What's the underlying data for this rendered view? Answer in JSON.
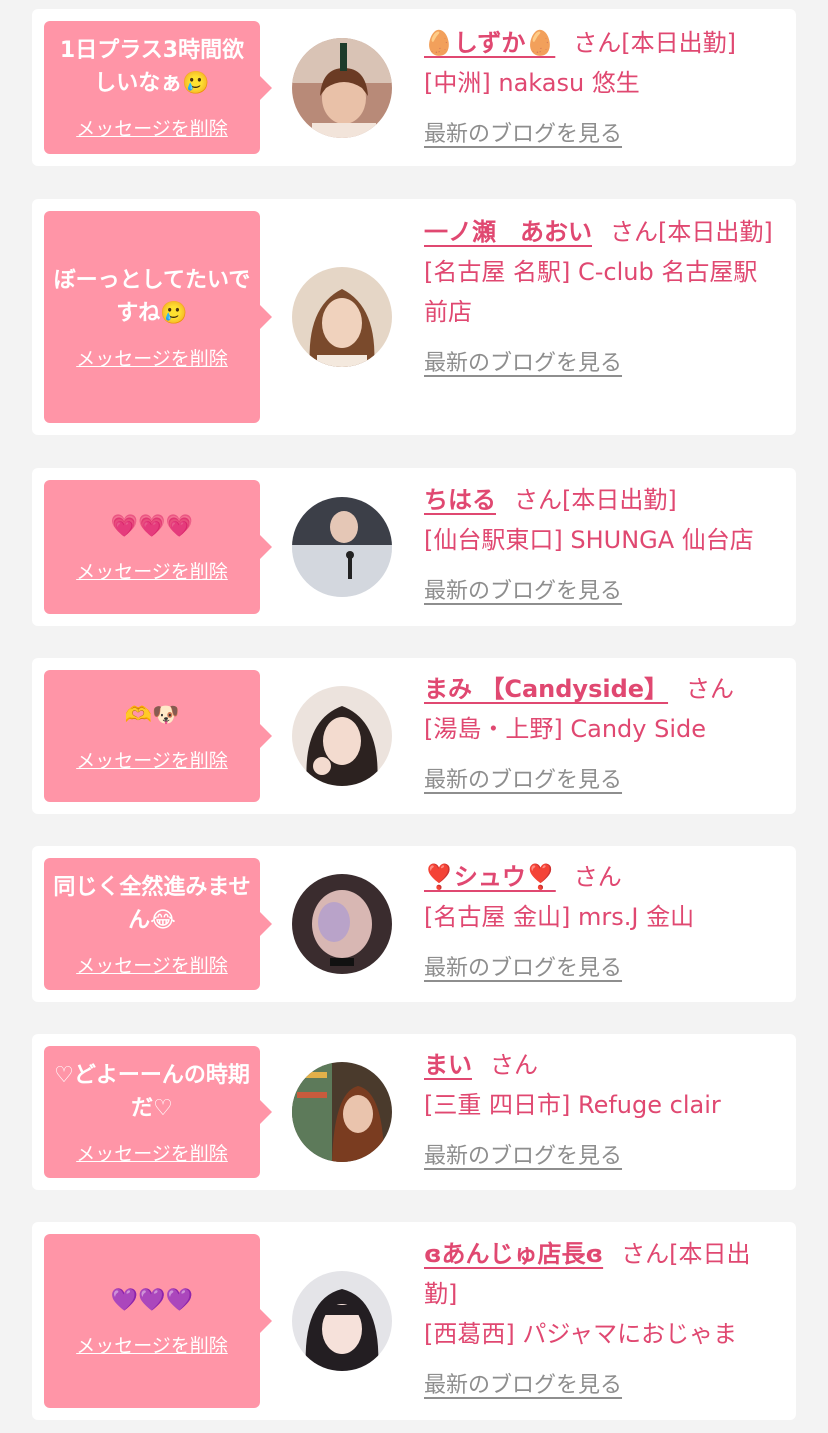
{
  "delete_label": "メッセージを削除",
  "blog_label": "最新のブログを見る",
  "colors": {
    "page_bg": "#f3f3f3",
    "bubble_pink": "#ff95a7",
    "name_pink": "#e04871",
    "blog_gray": "#8e8e8e"
  },
  "items": [
    {
      "message": "1日プラス3時間欲しいなぁ🥲",
      "name": "🥚しずか🥚",
      "honorific": "さん",
      "status": "[本日出勤]",
      "shop": "[中洲] nakasu 悠生"
    },
    {
      "message": "ぼーっとしてたいですね🥲",
      "name": "一ノ瀬　あおい",
      "honorific": "さん",
      "status": "[本日出勤]",
      "shop": "[名古屋 名駅] C-club 名古屋駅前店"
    },
    {
      "message": "💗💗💗",
      "name": "ちはる",
      "honorific": "さん",
      "status": "[本日出勤]",
      "shop": "[仙台駅東口] SHUNGA 仙台店"
    },
    {
      "message": "🫶🐶",
      "name": "まみ 【Candyside】",
      "honorific": "さん",
      "status": "",
      "shop": "[湯島・上野] Candy Side"
    },
    {
      "message": "同じく全然進みません😂",
      "name": "❣️シュウ❣️",
      "honorific": "さん",
      "status": "",
      "shop": "[名古屋 金山] mrs.J 金山"
    },
    {
      "message": "♡どよーーんの時期だ♡",
      "name": "まい",
      "honorific": "さん",
      "status": "",
      "shop": "[三重 四日市] Refuge clair"
    },
    {
      "message": "💜💜💜",
      "name": "ɞあんじゅ店長ɞ",
      "honorific": "さん",
      "status": "[本日出勤]",
      "shop": "[西葛西] パジャマにおじゃま"
    }
  ]
}
